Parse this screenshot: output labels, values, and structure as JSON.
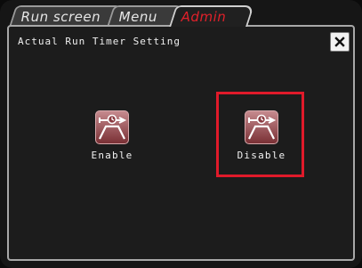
{
  "tabs": [
    {
      "label": "Run screen",
      "active": false
    },
    {
      "label": "Menu",
      "active": false
    },
    {
      "label": "Admin",
      "active": true
    }
  ],
  "dialog": {
    "title": "Actual Run Timer Setting",
    "close_symbol": "×"
  },
  "options": {
    "enable_label": "Enable",
    "disable_label": "Disable",
    "icon": "run-timer-icon",
    "selected": "Disable"
  },
  "colors": {
    "active_tab_text": "#e0202a",
    "highlight": "#e01a2a",
    "icon_fill": "#9b5156"
  }
}
